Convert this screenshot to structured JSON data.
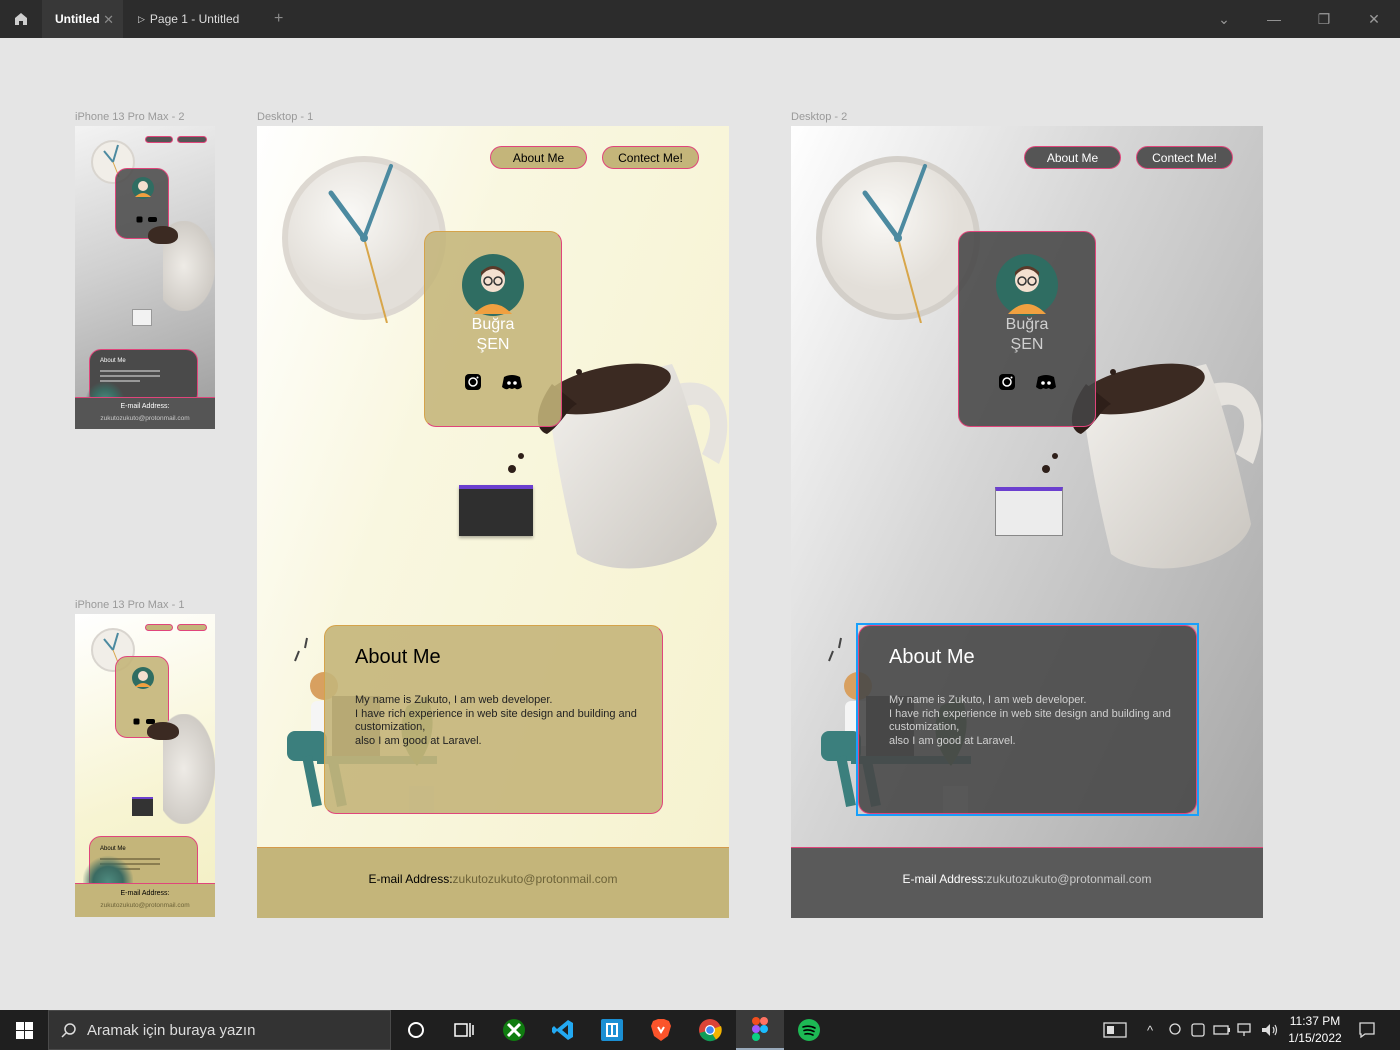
{
  "titlebar": {
    "tab_active": "Untitled",
    "tab_close": "✕",
    "tab2": "Page 1 - Untitled",
    "new_tab": "+",
    "dropdown": "⌄",
    "minimize": "—",
    "restore": "❐",
    "close": "✕"
  },
  "frames": {
    "iphone2": {
      "label": "iPhone 13 Pro Max - 2",
      "about_title": "About Me",
      "email_label": "E-mail  Address:",
      "email": "zukutozukuto@protonmail.com"
    },
    "iphone1": {
      "label": "iPhone 13 Pro Max - 1",
      "about_title": "About Me",
      "email_label": "E-mail  Address:",
      "email": "zukutozukuto@protonmail.com"
    },
    "desktop1": {
      "label": "Desktop - 1",
      "about_btn": "About Me",
      "contact_btn": "Contect Me!",
      "name_first": "Buğra",
      "name_last": "ŞEN",
      "about_title": "About Me",
      "about_line1": "My name is Zukuto, I am web developer.",
      "about_line2": "I have rich experience in web site design and building and",
      "about_line3": "customization,",
      "about_line4": "also I am good at Laravel.",
      "email_label": "E-mail  Address:",
      "email": "zukutozukuto@protonmail.com"
    },
    "desktop2": {
      "label": "Desktop - 2",
      "about_btn": "About Me",
      "contact_btn": "Contect Me!",
      "name_first": "Buğra",
      "name_last": "ŞEN",
      "about_title": "About Me",
      "about_line1": "My name is Zukuto, I am web developer.",
      "about_line2": "I have rich experience in web site design and building and",
      "about_line3": "customization,",
      "about_line4": "also I am good at Laravel.",
      "email_label": "E-mail  Address:",
      "email": "zukutozukuto@protonmail.com"
    }
  },
  "taskbar": {
    "search_placeholder": "Aramak için buraya yazın",
    "time": "11:37 PM",
    "date": "1/15/2022",
    "apps": [
      "cortana-icon",
      "task-view-icon",
      "xbox-icon",
      "vscode-icon",
      "app-icon",
      "brave-icon",
      "chrome-icon",
      "figma-icon",
      "spotify-icon"
    ]
  },
  "colors": {
    "accent_pink": "#e0457b",
    "cream": "#f7f4d2",
    "khaki": "#c4b57a",
    "dark_card": "#4d4d4d",
    "selection_blue": "#18a0fb",
    "footer_gray": "#5a5a5a"
  }
}
